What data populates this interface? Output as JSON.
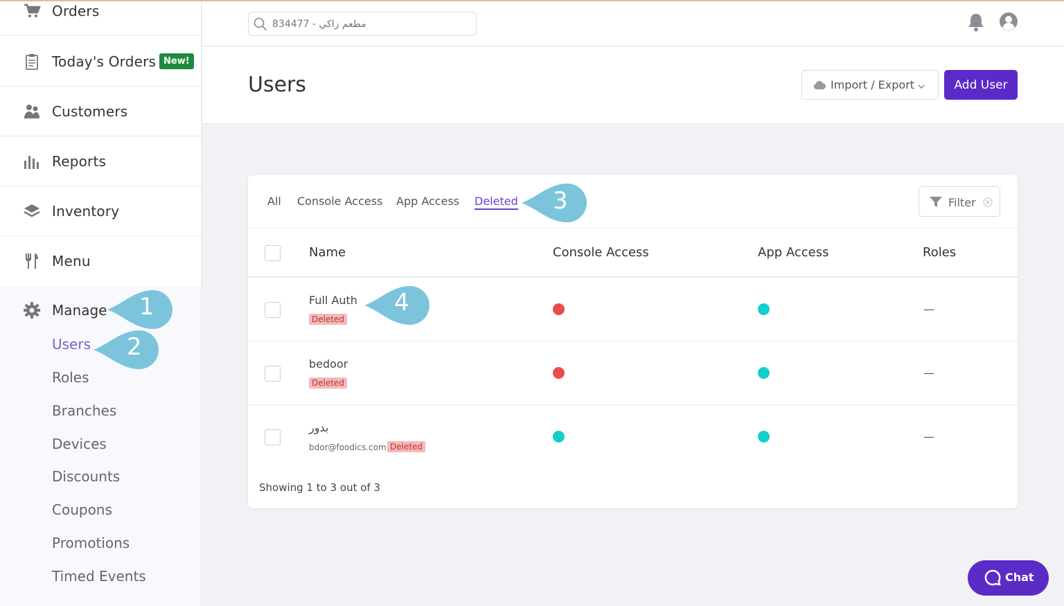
{
  "sidebar": {
    "items": [
      {
        "label": "Orders",
        "icon": "cart-icon"
      },
      {
        "label": "Today's Orders",
        "icon": "clipboard-icon",
        "badge": "New!"
      },
      {
        "label": "Customers",
        "icon": "customers-icon"
      },
      {
        "label": "Reports",
        "icon": "bar-chart-icon"
      },
      {
        "label": "Inventory",
        "icon": "layers-icon"
      },
      {
        "label": "Menu",
        "icon": "fork-knife-icon"
      }
    ],
    "manage": {
      "label": "Manage",
      "icon": "gear-icon",
      "sub_items": [
        "Users",
        "Roles",
        "Branches",
        "Devices",
        "Discounts",
        "Coupons",
        "Promotions",
        "Timed Events"
      ]
    }
  },
  "topbar": {
    "search_value": "834477 - مطعم زاكي"
  },
  "header": {
    "title": "Users",
    "import_label": "Import / Export",
    "add_label": "Add User"
  },
  "tabs": [
    "All",
    "Console Access",
    "App Access",
    "Deleted"
  ],
  "filter_label": "Filter",
  "table": {
    "columns": [
      "Name",
      "Console Access",
      "App Access",
      "Roles"
    ],
    "rows": [
      {
        "name": "Full Auth",
        "email": "",
        "tag": "Deleted",
        "console": "red",
        "app": "teal",
        "roles": "—"
      },
      {
        "name": "bedoor",
        "email": "",
        "tag": "Deleted",
        "console": "red",
        "app": "teal",
        "roles": "—"
      },
      {
        "name": "بدور",
        "email": "bdor@foodics.com",
        "tag": "Deleted",
        "console": "teal",
        "app": "teal",
        "roles": "—"
      }
    ]
  },
  "showing_text": "Showing 1 to 3 out of 3",
  "callouts": [
    "1",
    "2",
    "3",
    "4"
  ],
  "chat_label": "Chat",
  "colors": {
    "accent": "#5b2bc8",
    "active_tab": "#6a3fd4",
    "red": "#ea4b4b",
    "teal": "#12cfcf",
    "callout": "#7cc4dc"
  }
}
